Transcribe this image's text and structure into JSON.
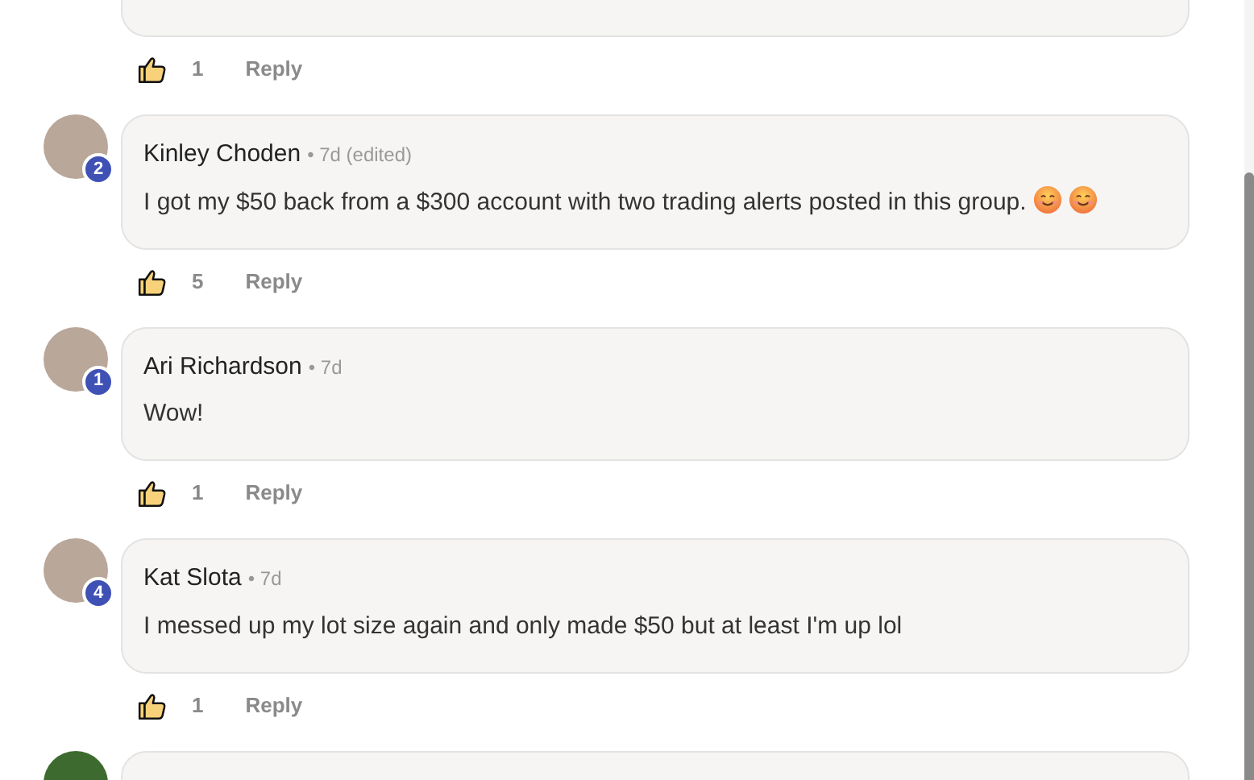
{
  "previous_comment": {
    "likes": "1",
    "reply_label": "Reply"
  },
  "comments": [
    {
      "author": "Kinley Choden",
      "time": "• 7d (edited)",
      "badge": "2",
      "text": "I got my $50 back from a $300 account with two trading alerts posted in this group.",
      "trailing_icons": [
        {
          "kind": "smiling-face"
        },
        {
          "kind": "smiling-face"
        }
      ],
      "likes": "5",
      "reply_label": "Reply"
    },
    {
      "author": "Ari Richardson",
      "time": "• 7d",
      "badge": "1",
      "text": "Wow!",
      "likes": "1",
      "reply_label": "Reply"
    },
    {
      "author": "Kat Slota",
      "time": "• 7d",
      "badge": "4",
      "text": "I messed up my lot size again and only made $50 but at least I'm up lol",
      "likes": "1",
      "reply_label": "Reply"
    }
  ],
  "next_comment_peek": true
}
